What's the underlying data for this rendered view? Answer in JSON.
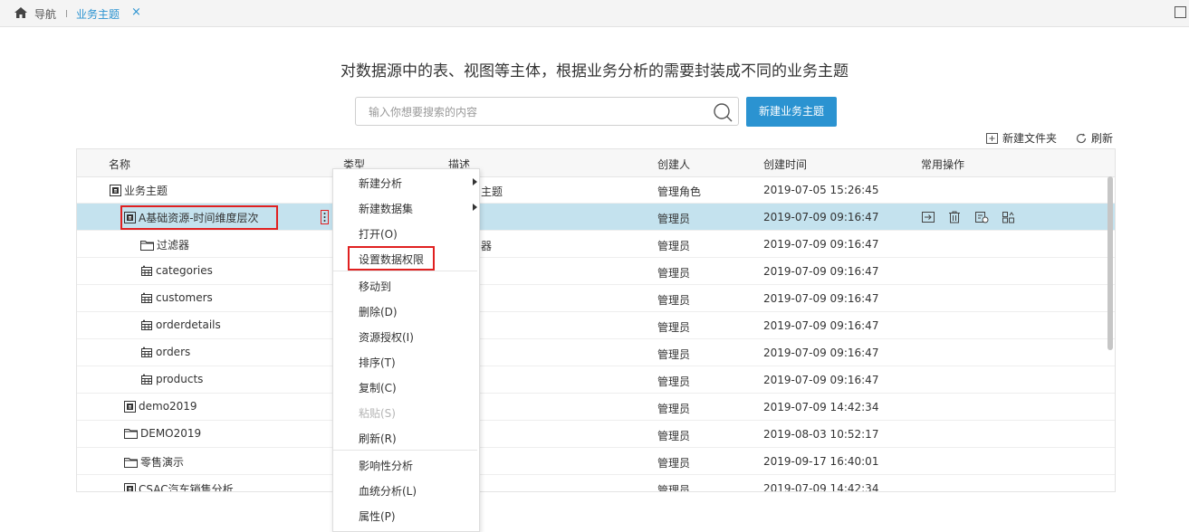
{
  "tabbar": {
    "nav_label": "导航",
    "tab_label": "业务主题",
    "close_glyph": "×"
  },
  "headline": "对数据源中的表、视图等主体，根据业务分析的需要封装成不同的业务主题",
  "search": {
    "placeholder": "输入你想要搜索的内容",
    "value": ""
  },
  "new_topic_button": "新建业务主题",
  "toolbar": {
    "new_folder": "新建文件夹",
    "refresh": "刷新"
  },
  "table": {
    "columns": [
      "名称",
      "类型",
      "描述",
      "创建人",
      "创建时间",
      "常用操作"
    ],
    "rows": [
      {
        "name": "业务主题",
        "icon": "topic-icon",
        "type": "",
        "desc": "主题",
        "creator": "管理角色",
        "time": "2019-07-05 15:26:45"
      },
      {
        "name": "A基础资源-时间维度层次",
        "icon": "topic-icon",
        "type": "",
        "desc": "",
        "creator": "管理员",
        "time": "2019-07-09 09:16:47",
        "selected": true
      },
      {
        "name": "过滤器",
        "icon": "folder-icon",
        "type": "",
        "desc": "器",
        "creator": "管理员",
        "time": "2019-07-09 09:16:47"
      },
      {
        "name": "categories",
        "icon": "table-icon",
        "type": "",
        "desc": "",
        "creator": "管理员",
        "time": "2019-07-09 09:16:47"
      },
      {
        "name": "customers",
        "icon": "table-icon",
        "type": "",
        "desc": "",
        "creator": "管理员",
        "time": "2019-07-09 09:16:47"
      },
      {
        "name": "orderdetails",
        "icon": "table-icon",
        "type": "",
        "desc": "",
        "creator": "管理员",
        "time": "2019-07-09 09:16:47"
      },
      {
        "name": "orders",
        "icon": "table-icon",
        "type": "",
        "desc": "",
        "creator": "管理员",
        "time": "2019-07-09 09:16:47"
      },
      {
        "name": "products",
        "icon": "table-icon",
        "type": "",
        "desc": "",
        "creator": "管理员",
        "time": "2019-07-09 09:16:47"
      },
      {
        "name": "demo2019",
        "icon": "topic-icon",
        "type": "",
        "desc": "",
        "creator": "管理员",
        "time": "2019-07-09 14:42:34"
      },
      {
        "name": "DEMO2019",
        "icon": "folder-icon",
        "type": "",
        "desc": "",
        "creator": "管理员",
        "time": "2019-08-03 10:52:17"
      },
      {
        "name": "零售演示",
        "icon": "folder-icon",
        "type": "",
        "desc": "",
        "creator": "管理员",
        "time": "2019-09-17 16:40:01"
      },
      {
        "name": "CSAC汽车销售分析",
        "icon": "topic-icon",
        "type": "",
        "desc": "",
        "creator": "管理员",
        "time": "2019-07-09 14:42:34"
      }
    ]
  },
  "context_menu": [
    {
      "label": "新建分析",
      "submenu": true
    },
    {
      "label": "新建数据集",
      "submenu": true
    },
    {
      "label": "打开(O)"
    },
    {
      "label": "设置数据权限",
      "highlighted": true
    },
    {
      "label": "移动到"
    },
    {
      "label": "删除(D)"
    },
    {
      "label": "资源授权(I)"
    },
    {
      "label": "排序(T)"
    },
    {
      "label": "复制(C)"
    },
    {
      "label": "粘贴(S)",
      "disabled": true
    },
    {
      "label": "刷新(R)"
    },
    {
      "label": "影响性分析"
    },
    {
      "label": "血统分析(L)"
    },
    {
      "label": "属性(P)"
    }
  ],
  "colors": {
    "accent": "#2b93d1",
    "selected_row": "#c4e2ee",
    "highlight_border": "#e02020"
  }
}
